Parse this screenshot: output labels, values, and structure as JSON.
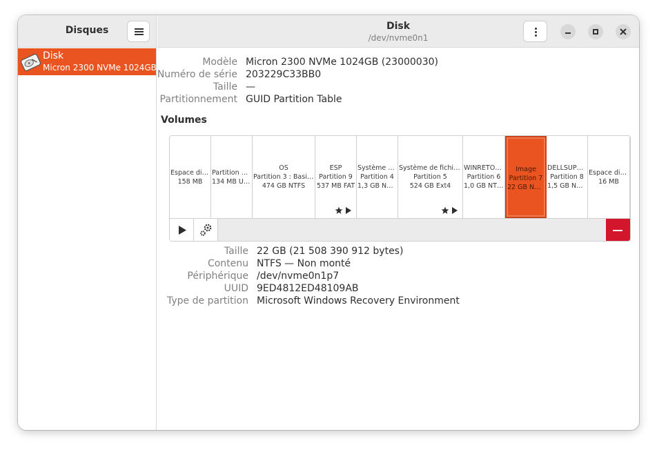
{
  "sidebar": {
    "title": "Disques",
    "disks": [
      {
        "name": "Disk",
        "model": "Micron 2300 NVMe 1024GB"
      }
    ]
  },
  "header": {
    "title": "Disk",
    "subtitle": "/dev/nvme0n1"
  },
  "disk_info": [
    {
      "label": "Modèle",
      "value": "Micron 2300 NVMe 1024GB (23000030)"
    },
    {
      "label": "Numéro de série",
      "value": "203229C33BB0"
    },
    {
      "label": "Taille",
      "value": "—"
    },
    {
      "label": "Partitionnement",
      "value": "GUID Partition Table"
    }
  ],
  "volumes_title": "Volumes",
  "volumes": [
    {
      "lines": [
        "Espace disp…",
        "158 MB"
      ]
    },
    {
      "lines": [
        "Partition 2 : …",
        "134 MB Unk…"
      ]
    },
    {
      "lines": [
        "OS",
        "Partition 3 : Basic da…",
        "474 GB NTFS"
      ]
    },
    {
      "lines": [
        "ESP",
        "Partition 9",
        "537 MB FAT"
      ],
      "badges": true
    },
    {
      "lines": [
        "Système de …",
        "Partition 4",
        "1,3 GB NTFS"
      ]
    },
    {
      "lines": [
        "Système de fichiers",
        "Partition 5",
        "524 GB Ext4"
      ],
      "badges": true
    },
    {
      "lines": [
        "WINRETOOLS",
        "Partition 6",
        "1,0 GB NTFS"
      ]
    },
    {
      "lines": [
        "Image",
        "Partition 7",
        "22 GB NTFS"
      ],
      "selected": true
    },
    {
      "lines": [
        "DELLSUPPO…",
        "Partition 8",
        "1,5 GB NTFS"
      ]
    },
    {
      "lines": [
        "Espace dispo…",
        "16 MB"
      ]
    }
  ],
  "volume_toolbar": {
    "icons": [
      "play-icon",
      "gears-icon",
      "minus-icon"
    ]
  },
  "partition_info": [
    {
      "label": "Taille",
      "value": "22 GB (21 508 390 912 bytes)"
    },
    {
      "label": "Contenu",
      "value": "NTFS — Non monté"
    },
    {
      "label": "Périphérique",
      "value": "/dev/nvme0n1p7"
    },
    {
      "label": "UUID",
      "value": "9ED4812ED48109AB"
    },
    {
      "label": "Type de partition",
      "value": "Microsoft Windows Recovery Environment"
    }
  ],
  "colors": {
    "accent": "#e95420",
    "destructive": "#d4162c",
    "header_bg": "#ebebeb"
  }
}
